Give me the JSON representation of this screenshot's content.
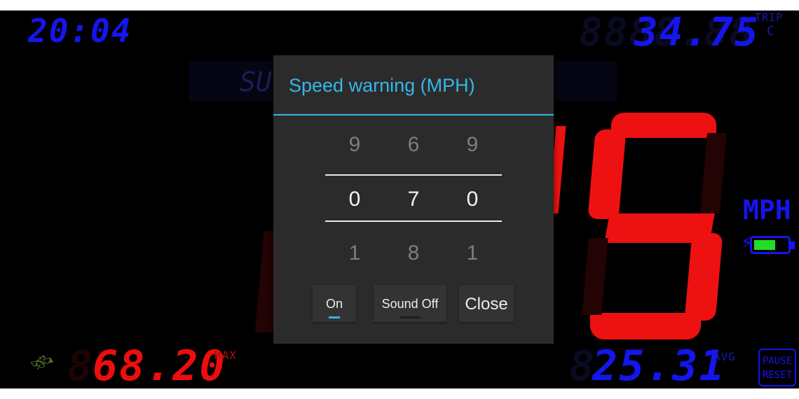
{
  "clock": {
    "time": "20:04",
    "ghost": "88:88"
  },
  "trip": {
    "value": "34.75",
    "ghost": "8888.88",
    "label_top": "TRIP",
    "label_bottom": "C"
  },
  "speed_unit": "MPH",
  "current_speed_digit": "5",
  "battery": {
    "level": 0.65,
    "color": "#22dd22"
  },
  "max_speed": {
    "value": "68.20",
    "ghost": "8",
    "label": "MAX"
  },
  "avg_speed": {
    "value": "25.31",
    "ghost": "8",
    "label": "AVG"
  },
  "pause_reset": {
    "line1": "PAUSE",
    "line2": "RESET"
  },
  "dialog": {
    "title": "Speed warning (MPH)",
    "picker": {
      "above": [
        "9",
        "6",
        "9"
      ],
      "selected": [
        "0",
        "7",
        "0"
      ],
      "below": [
        "1",
        "8",
        "1"
      ]
    },
    "buttons": {
      "on_label": "On",
      "sound_label": "Sound Off",
      "close_label": "Close"
    }
  },
  "colors": {
    "accent": "#35b6e8",
    "lcd_blue": "#1515ee",
    "lcd_red": "#ee0d0d"
  }
}
